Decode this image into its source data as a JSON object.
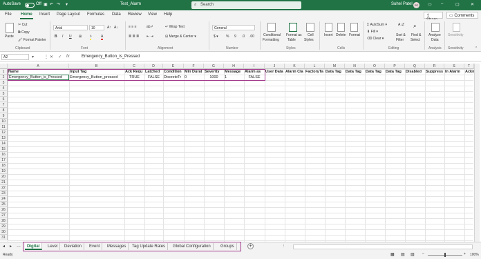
{
  "titlebar": {
    "autosave_label": "AutoSave",
    "autosave_state": "Off",
    "filename": "Test_Alarm",
    "search_placeholder": "Search",
    "user_name": "Suhel Patel",
    "user_initials": "SP"
  },
  "menu": {
    "tabs": [
      "File",
      "Home",
      "Insert",
      "Page Layout",
      "Formulas",
      "Data",
      "Review",
      "View",
      "Help"
    ],
    "active_tab": "Home",
    "share_label": "Share",
    "comments_label": "Comments"
  },
  "ribbon": {
    "clipboard": {
      "paste": "Paste",
      "cut": "Cut",
      "copy": "Copy",
      "format_painter": "Format Painter",
      "group": "Clipboard"
    },
    "font": {
      "name": "Arial",
      "size": "10",
      "bold": "B",
      "italic": "I",
      "underline": "U",
      "group": "Font"
    },
    "alignment": {
      "wrap_text": "Wrap Text",
      "merge_center": "Merge & Center",
      "group": "Alignment"
    },
    "number": {
      "format": "General",
      "group": "Number"
    },
    "styles": {
      "conditional": "Conditional",
      "formatting": "Formatting",
      "format_as": "Format as",
      "table": "Table",
      "cell": "Cell",
      "styles_label": "Styles",
      "group": "Styles"
    },
    "cells": {
      "insert": "Insert",
      "delete": "Delete",
      "format": "Format",
      "group": "Cells"
    },
    "editing": {
      "autosum": "AutoSum",
      "fill": "Fill",
      "clear": "Clear",
      "sort_filter": "Sort &",
      "filter": "Filter",
      "find_select": "Find &",
      "select": "Select",
      "group": "Editing"
    },
    "analysis": {
      "analyze": "Analyze",
      "data": "Data",
      "group": "Analysis"
    },
    "sensitivity": {
      "label": "Sensitivity",
      "group": "Sensitivity"
    }
  },
  "formula_bar": {
    "name_box": "A2",
    "fx": "fx",
    "content": "Emergency_Button_is_Pressed"
  },
  "sheet": {
    "columns": [
      "A",
      "B",
      "C",
      "D",
      "E",
      "F",
      "G",
      "H",
      "I",
      "J",
      "K",
      "L",
      "M",
      "N",
      "O",
      "P",
      "Q",
      "R",
      "S",
      "T"
    ],
    "row_numbers": [
      "1",
      "2",
      "3",
      "4",
      "5",
      "6",
      "7",
      "8",
      "9",
      "10",
      "11",
      "12",
      "13",
      "14",
      "15",
      "16",
      "17",
      "18",
      "19",
      "20",
      "21",
      "22",
      "23",
      "24",
      "25",
      "26",
      "27",
      "28",
      "29",
      "30",
      "31"
    ],
    "header_row": [
      "Name",
      "Input Tag",
      "Ack Requ",
      "Latched",
      "Condition",
      "Min Durat",
      "Severity",
      "Message",
      "Alarm as",
      "User Data",
      "Alarm Cla",
      "FactoryTa",
      "Data Tag",
      "Data Tag",
      "Data Tag",
      "Data Tag",
      "Disabled",
      "Suppress",
      "In Alarm",
      "Ackn"
    ],
    "data_row": [
      "Emergency_Button_is_Pressed",
      "Emergency_Button_pressed",
      "TRUE",
      "FALSE",
      "DiscreteTr",
      "0",
      "1000",
      "1",
      "FALSE"
    ]
  },
  "sheet_tabs": [
    "Digital",
    "Level",
    "Deviation",
    "Event",
    "Messages",
    "Tag Update Rates",
    "Global Configuration",
    "Groups"
  ],
  "active_sheet": "Digital",
  "status": {
    "ready": "Ready",
    "zoom": "100%"
  },
  "colors": {
    "excel_green": "#217346",
    "highlight": "#a23b8c"
  }
}
